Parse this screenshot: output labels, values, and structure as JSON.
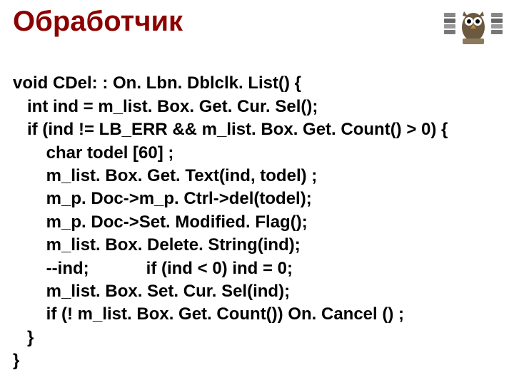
{
  "title": "Обработчик",
  "code": {
    "line1": "void CDel: : On. Lbn. Dblclk. List() {",
    "line2": "   int ind = m_list. Box. Get. Cur. Sel();",
    "line3": "   if (ind != LB_ERR && m_list. Box. Get. Count() > 0) {",
    "line4": "       char todel [60] ;",
    "line5": "       m_list. Box. Get. Text(ind, todel) ;",
    "line6": "       m_p. Doc->m_p. Ctrl->del(todel);",
    "line7": "       m_p. Doc->Set. Modified. Flag();",
    "line8": "       m_list. Box. Delete. String(ind);",
    "line9": "       --ind;            if (ind < 0) ind = 0;",
    "line10": "       m_list. Box. Set. Cur. Sel(ind);",
    "line11": "       if (! m_list. Box. Get. Count()) On. Cancel () ;",
    "line12": "   }",
    "line13": "}"
  }
}
